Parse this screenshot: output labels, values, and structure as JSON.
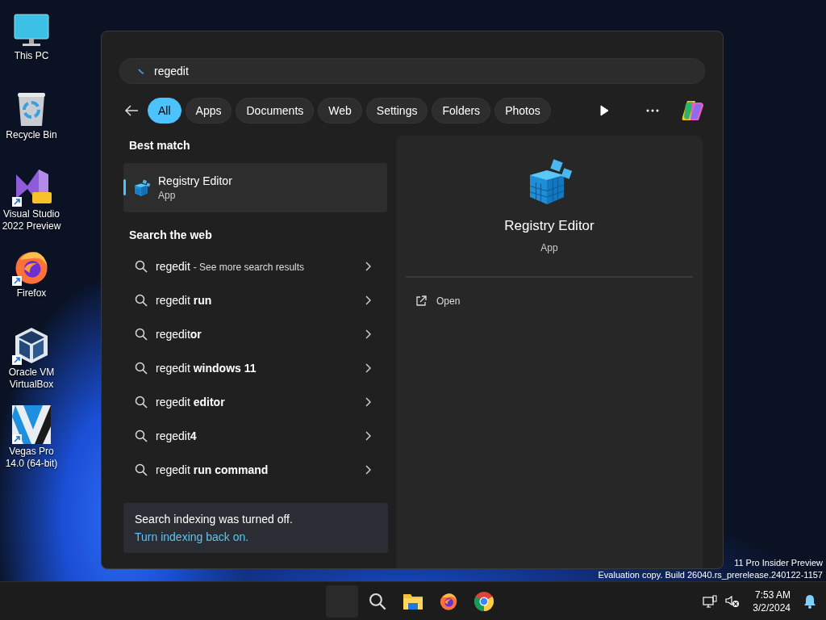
{
  "desktop_icons": [
    {
      "label": "This PC",
      "kind": "monitor",
      "shortcut": false
    },
    {
      "label": "Recycle Bin",
      "kind": "bin",
      "shortcut": false
    },
    {
      "label": "Visual Studio 2022 Preview",
      "kind": "studio",
      "shortcut": true
    },
    {
      "label": "Firefox",
      "kind": "firefox",
      "shortcut": true
    },
    {
      "label": "Oracle VM VirtualBox",
      "kind": "cube",
      "shortcut": true
    },
    {
      "label": "Vegas Pro 14.0 (64-bit)",
      "kind": "vegas",
      "shortcut": true
    }
  ],
  "search": {
    "query": "regedit",
    "filters": [
      {
        "label": "All",
        "selected": true
      },
      {
        "label": "Apps",
        "selected": false
      },
      {
        "label": "Documents",
        "selected": false
      },
      {
        "label": "Web",
        "selected": false
      },
      {
        "label": "Settings",
        "selected": false
      },
      {
        "label": "Folders",
        "selected": false
      },
      {
        "label": "Photos",
        "selected": false
      }
    ],
    "best_match": {
      "heading": "Best match",
      "title": "Registry Editor",
      "subtitle": "App",
      "selected": true
    },
    "web": {
      "heading": "Search the web",
      "items": [
        {
          "text": "regedit",
          "note": "- See more search results"
        },
        {
          "text": "regedit **run**"
        },
        {
          "text": "regedit**or**"
        },
        {
          "text": "regedit **windows 11**"
        },
        {
          "text": "regedit **editor**"
        },
        {
          "text": "regedit**4**"
        },
        {
          "text": "regedit **run command**"
        }
      ]
    },
    "notice": {
      "text": "Search indexing was turned off.",
      "link": "Turn indexing back on."
    },
    "detail": {
      "title": "Registry Editor",
      "subtitle": "App",
      "actions": [
        {
          "label": "Open"
        }
      ]
    }
  },
  "watermark": {
    "line1": "11 Pro Insider Preview",
    "line2": "Evaluation copy. Build 26040.rs_prerelease.240122-1157"
  },
  "taskbar": {
    "apps": [
      {
        "kind": "blank"
      },
      {
        "kind": "search"
      },
      {
        "kind": "folder"
      },
      {
        "kind": "firefox"
      },
      {
        "kind": "chrome"
      }
    ],
    "time": "7:53 AM",
    "date": "3/2/2024"
  }
}
